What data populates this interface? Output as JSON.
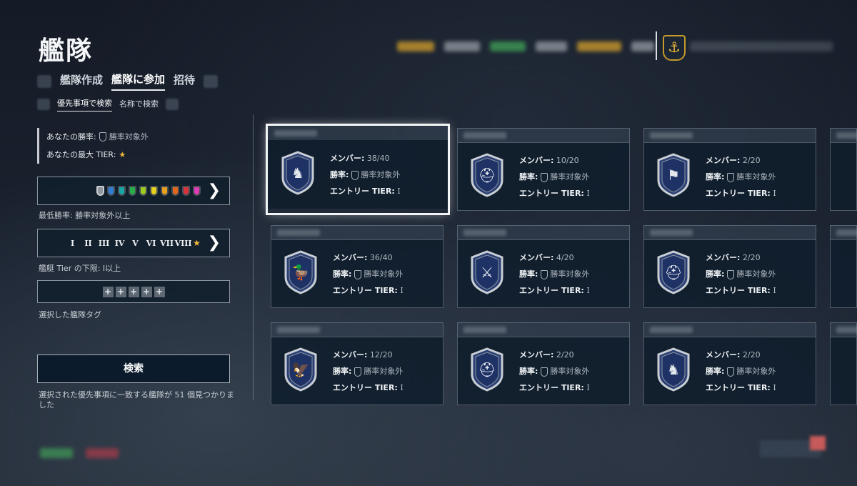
{
  "header": {
    "title": "艦隊"
  },
  "tabs": [
    {
      "label": "艦隊作成",
      "active": false
    },
    {
      "label": "艦隊に参加",
      "active": true
    },
    {
      "label": "招待",
      "active": false
    }
  ],
  "subtabs": [
    {
      "label": "優先事項で検索",
      "active": true
    },
    {
      "label": "名称で検索",
      "active": false
    }
  ],
  "player": {
    "winrate_label": "あなたの勝率:",
    "winrate_value": "勝率対象外",
    "max_tier_label": "あなたの最大 TIER:"
  },
  "filters": {
    "winrate_caption": "最低勝率: 勝率対象外以上",
    "winrate_colors": [
      "#8f969c",
      "#2f7fd6",
      "#19a6a6",
      "#27b04a",
      "#9ccc1f",
      "#e6d11f",
      "#e8a01c",
      "#e2661c",
      "#d8323a",
      "#e03ab5"
    ],
    "tiers": [
      "I",
      "II",
      "III",
      "IV",
      "V",
      "VI",
      "VII",
      "VIII"
    ],
    "tier_caption": "艦艇 Tier の下限: I以上",
    "tag_caption": "選択した艦隊タグ",
    "tag_slots": [
      "+",
      "+",
      "+",
      "+",
      "+"
    ]
  },
  "search_button": "検索",
  "result_text": "選択された優先事項に一致する艦隊が 51 個見つかりました",
  "labels": {
    "members": "メンバー:",
    "winrate": "勝率:",
    "entry_tier": "エントリー TIER:"
  },
  "fleets": [
    {
      "members": "38/40",
      "winrate": "勝率対象外",
      "entry_tier": "I",
      "emblem": "griffin-lion-emblem-icon",
      "emblem_glyph": "♞",
      "selected": true
    },
    {
      "members": "10/20",
      "winrate": "勝率対象外",
      "entry_tier": "I",
      "emblem": "knight-helmet-emblem-icon",
      "emblem_glyph": "⛑"
    },
    {
      "members": "2/20",
      "winrate": "勝率対象外",
      "entry_tier": "I",
      "emblem": "flag-emblem-icon",
      "emblem_glyph": "⚑"
    },
    {
      "members": "36/40",
      "winrate": "勝率対象外",
      "entry_tier": "I",
      "emblem": "duck-emblem-icon",
      "emblem_glyph": "🦆"
    },
    {
      "members": "4/20",
      "winrate": "勝率対象外",
      "entry_tier": "I",
      "emblem": "crossed-swords-emblem-icon",
      "emblem_glyph": "⚔"
    },
    {
      "members": "2/20",
      "winrate": "勝率対象外",
      "entry_tier": "I",
      "emblem": "helmet-emblem-icon",
      "emblem_glyph": "⛑"
    },
    {
      "members": "12/20",
      "winrate": "勝率対象外",
      "entry_tier": "I",
      "emblem": "eagle-emblem-icon",
      "emblem_glyph": "🦅"
    },
    {
      "members": "2/20",
      "winrate": "勝率対象外",
      "entry_tier": "I",
      "emblem": "knight-helmet-emblem-icon",
      "emblem_glyph": "⛑"
    },
    {
      "members": "2/20",
      "winrate": "勝率対象外",
      "entry_tier": "I",
      "emblem": "lion-emblem-icon",
      "emblem_glyph": "♞"
    }
  ],
  "colors": {
    "accent_gold": "#c59a2a",
    "star": "#f2b83a"
  }
}
